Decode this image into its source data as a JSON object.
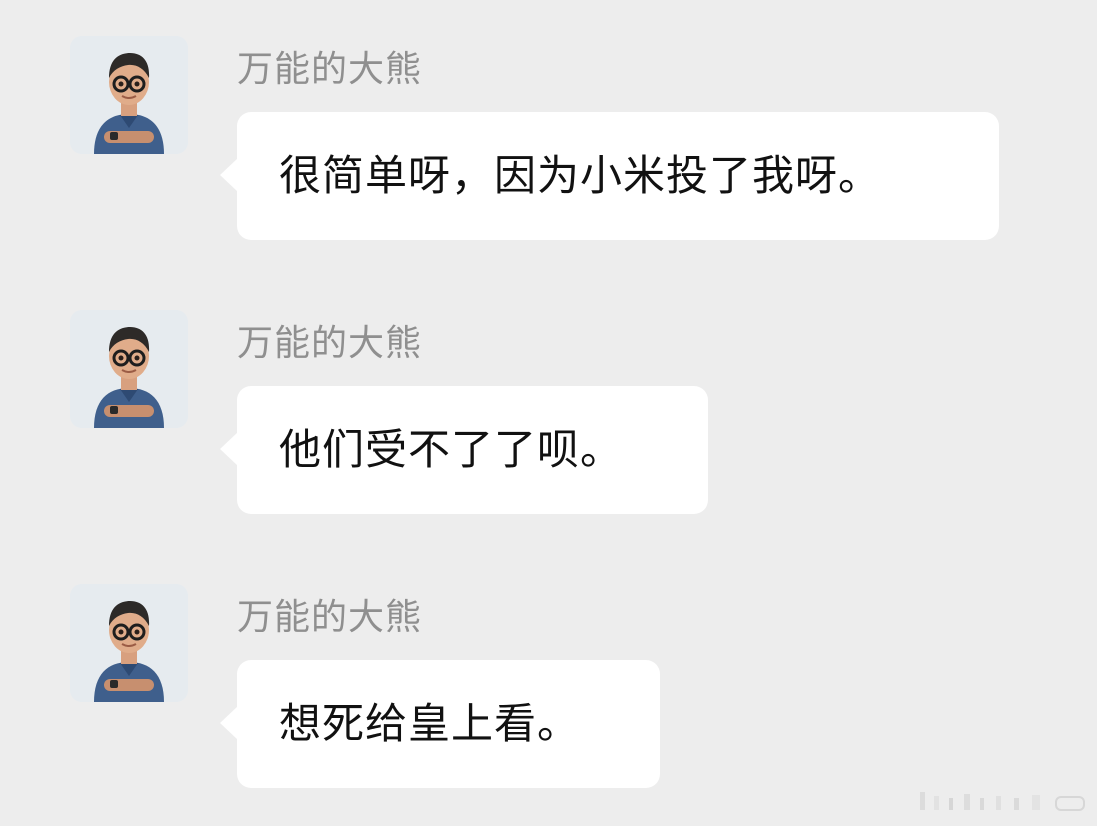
{
  "conversation": {
    "messages": [
      {
        "sender": "万能的大熊",
        "text": "很简单呀，因为小米投了我呀。",
        "avatar_icon": "cartoon-man-avatar"
      },
      {
        "sender": "万能的大熊",
        "text": "他们受不了了呗。",
        "avatar_icon": "cartoon-man-avatar"
      },
      {
        "sender": "万能的大熊",
        "text": "想死给皇上看。",
        "avatar_icon": "cartoon-man-avatar"
      }
    ]
  },
  "colors": {
    "background": "#ededed",
    "bubble": "#ffffff",
    "sender_name": "#8f8f8f",
    "message_text": "#111111",
    "avatar_shirt": "#3f5f8c"
  }
}
